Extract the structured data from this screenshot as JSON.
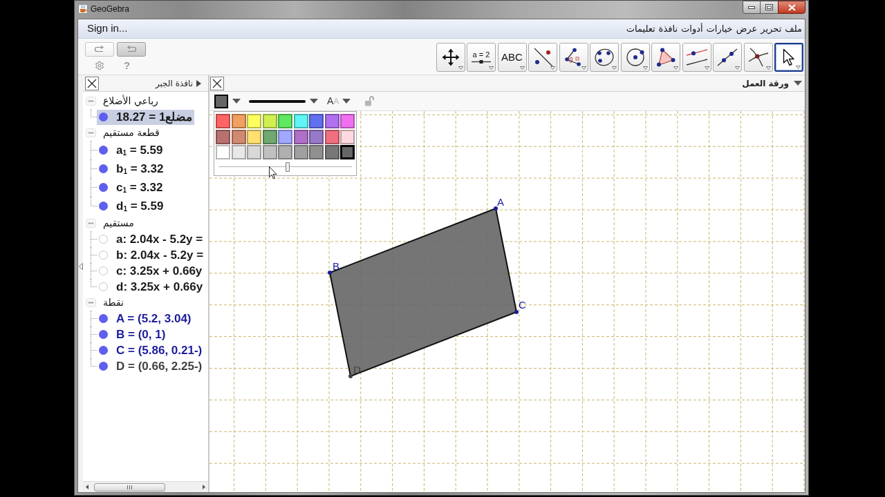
{
  "window": {
    "title": "GeoGebra"
  },
  "menu_bar": {
    "sign_in": "Sign in...",
    "items": [
      "ملف",
      "تحرير",
      "عرض",
      "خيارات",
      "أدوات",
      "نافذة",
      "تعليمات"
    ]
  },
  "toolbar": {
    "history": [
      {
        "kind": "redo",
        "pressed": false
      },
      {
        "kind": "undo",
        "pressed": true
      }
    ],
    "help": "?",
    "tools": [
      {
        "kind": "pointer",
        "selected": true
      },
      {
        "kind": "intersect",
        "selected": false
      },
      {
        "kind": "line",
        "selected": false
      },
      {
        "kind": "parallel",
        "selected": false
      },
      {
        "kind": "polygon",
        "selected": false
      },
      {
        "kind": "circle",
        "selected": false
      },
      {
        "kind": "conic",
        "selected": false
      },
      {
        "kind": "angle",
        "selected": false
      },
      {
        "kind": "reflect",
        "selected": false
      },
      {
        "kind": "text",
        "label": "ABC",
        "selected": false
      },
      {
        "kind": "slider",
        "label": "a = 2",
        "selected": false
      },
      {
        "kind": "move_view",
        "selected": false
      }
    ]
  },
  "algebra_view": {
    "title": "نافذة الجبر",
    "groups": [
      {
        "label": "رباعي الأضلاع",
        "expanded": true,
        "children": [
          {
            "text": "مضلع1 = 18.27",
            "visible": true,
            "selected": true
          }
        ]
      },
      {
        "label": "قطعة مستقيم",
        "expanded": true,
        "children": [
          {
            "text": "a$_{1}$ = 5.59",
            "visible": true,
            "selected": false
          },
          {
            "text": "b$_{1}$ = 3.32",
            "visible": true,
            "selected": false
          },
          {
            "text": "c$_{1}$ = 3.32",
            "visible": true,
            "selected": false
          },
          {
            "text": "d$_{1}$ = 5.59",
            "visible": true,
            "selected": false
          }
        ]
      },
      {
        "label": "مستقيم",
        "expanded": true,
        "children": [
          {
            "text": "a: 2.04x - 5.2y =",
            "visible": false,
            "selected": false
          },
          {
            "text": "b: 2.04x - 5.2y =",
            "visible": false,
            "selected": false
          },
          {
            "text": "c: 3.25x + 0.66y",
            "visible": false,
            "selected": false
          },
          {
            "text": "d: 3.25x + 0.66y",
            "visible": false,
            "selected": false
          }
        ]
      },
      {
        "label": "نقطة",
        "expanded": true,
        "children": [
          {
            "text": "A = (5.2, 3.04)",
            "visible": true,
            "selected": false,
            "color": "#1c1c9c"
          },
          {
            "text": "B = (0, 1)",
            "visible": true,
            "selected": false,
            "color": "#1c1c9c"
          },
          {
            "text": "C = (5.86, 0.21-)",
            "visible": true,
            "selected": false,
            "color": "#1c1c9c"
          },
          {
            "text": "D = (0.66, 2.25-)",
            "visible": true,
            "selected": false,
            "color": "#404040"
          }
        ]
      }
    ]
  },
  "graphics_view": {
    "title": "ورقة العمل",
    "style_bar": {
      "text_style": "AA",
      "color_popup": {
        "swatches": [
          {
            "color": "#ff6464",
            "selected": false
          },
          {
            "color": "#f0a060",
            "selected": false
          },
          {
            "color": "#ffff60",
            "selected": false
          },
          {
            "color": "#d0f050",
            "selected": false
          },
          {
            "color": "#60e860",
            "selected": false
          },
          {
            "color": "#60f4f4",
            "selected": false
          },
          {
            "color": "#6070f0",
            "selected": false
          },
          {
            "color": "#b070f0",
            "selected": false
          },
          {
            "color": "#f070f0",
            "selected": false
          },
          {
            "color": "#b87070",
            "selected": false
          },
          {
            "color": "#d08a70",
            "selected": false
          },
          {
            "color": "#ffe070",
            "selected": false
          },
          {
            "color": "#70a870",
            "selected": false
          },
          {
            "color": "#a0a8ff",
            "selected": false
          },
          {
            "color": "#b070c8",
            "selected": false
          },
          {
            "color": "#9878c8",
            "selected": false
          },
          {
            "color": "#f07080",
            "selected": false
          },
          {
            "color": "#ffd8e0",
            "selected": false
          },
          {
            "color": "#ffffff",
            "selected": false
          },
          {
            "color": "#e8e8e8",
            "selected": false
          },
          {
            "color": "#d8d8d8",
            "selected": false
          },
          {
            "color": "#c0c0c0",
            "selected": false
          },
          {
            "color": "#b0b0b0",
            "selected": false
          },
          {
            "color": "#a0a0a0",
            "selected": false
          },
          {
            "color": "#909090",
            "selected": false
          },
          {
            "color": "#787878",
            "selected": false
          },
          {
            "color": "#666666",
            "selected": true
          }
        ],
        "opacity": {
          "level": 0.52
        }
      }
    },
    "canvas": {
      "points": [
        {
          "label": "A",
          "color": "#1c1c9c"
        },
        {
          "label": "B",
          "color": "#1c1c9c"
        },
        {
          "label": "C",
          "color": "#1c1c9c"
        },
        {
          "label": "D",
          "color": "#404040"
        }
      ]
    }
  }
}
